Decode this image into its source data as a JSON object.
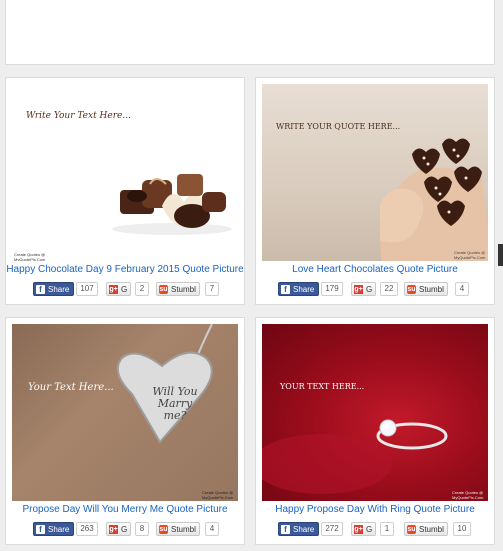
{
  "cards": [
    {
      "title": "Happy Chocolate Day 9 February 2015 Quote Picture",
      "image_text": "Write Your Text Here...",
      "watermark": "Create Quotes @ MyQuotePic.Com",
      "facebook": {
        "label": "Share",
        "count": "107"
      },
      "google": {
        "label": "G",
        "count": "2"
      },
      "stumble": {
        "label": "Stumbl",
        "count": "7"
      }
    },
    {
      "title": "Love Heart Chocolates Quote Picture",
      "image_text": "WRITE YOUR QUOTE HERE...",
      "watermark": "Create Quotes @ MyQuotePic.Com",
      "facebook": {
        "label": "Share",
        "count": "179"
      },
      "google": {
        "label": "G",
        "count": "22"
      },
      "stumble": {
        "label": "Stumbl",
        "count": "4"
      }
    },
    {
      "title": "Propose Day Will You Merry Me Quote Picture",
      "image_text": "Your Text Here...",
      "pendant_text": [
        "Will You",
        "Marry",
        "me?"
      ],
      "watermark": "Create Quotes @ MyQuotePic.Com",
      "facebook": {
        "label": "Share",
        "count": "263"
      },
      "google": {
        "label": "G",
        "count": "8"
      },
      "stumble": {
        "label": "Stumbl",
        "count": "4"
      }
    },
    {
      "title": "Happy Propose Day With Ring Quote Picture",
      "image_text": "YOUR TEXT HERE...",
      "watermark": "Create Quotes @ MyQuotePic.Com",
      "facebook": {
        "label": "Share",
        "count": "272"
      },
      "google": {
        "label": "G",
        "count": "1"
      },
      "stumble": {
        "label": "Stumbl",
        "count": "10"
      }
    }
  ]
}
